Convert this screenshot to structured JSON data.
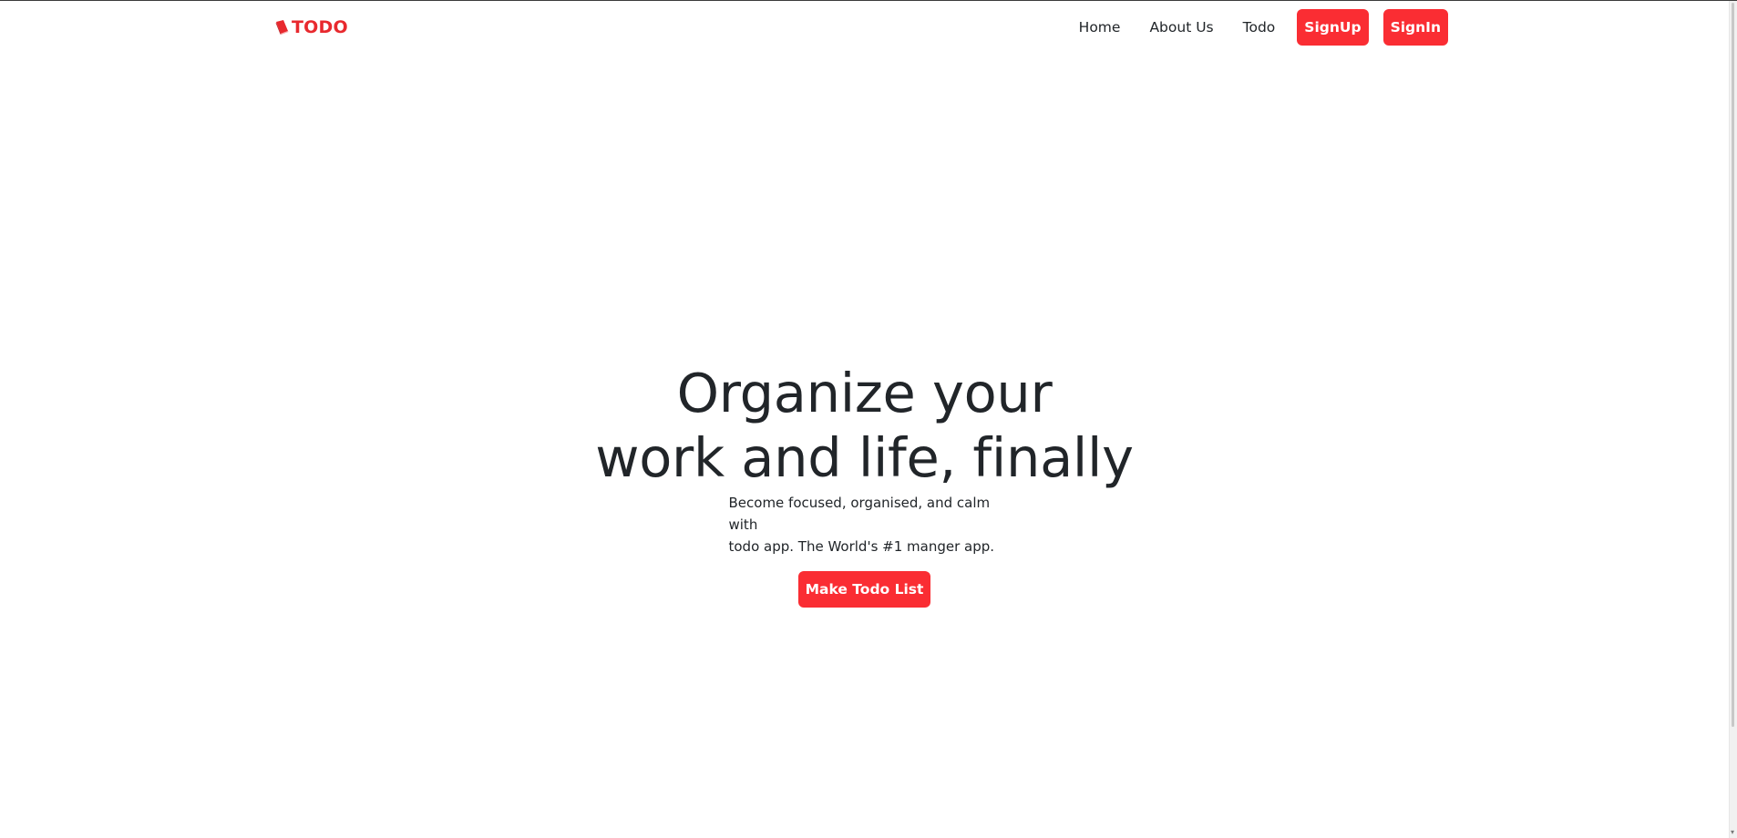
{
  "navbar": {
    "brand": {
      "icon": "book-icon",
      "label": "TODO"
    },
    "links": [
      {
        "label": "Home"
      },
      {
        "label": "About Us"
      },
      {
        "label": "Todo"
      }
    ],
    "buttons": {
      "signup": "SignUp",
      "signin": "SignIn"
    }
  },
  "hero": {
    "title_line1": "Organize your",
    "title_line2": "work and life, finally",
    "subtitle_line1": "Become focused, organised, and calm with",
    "subtitle_line2": "todo app. The World's #1 manger app.",
    "cta": "Make Todo List"
  },
  "colors": {
    "brand": "#e8292e",
    "button": "#fa2d33",
    "text": "#212529",
    "background": "#ffffff"
  }
}
